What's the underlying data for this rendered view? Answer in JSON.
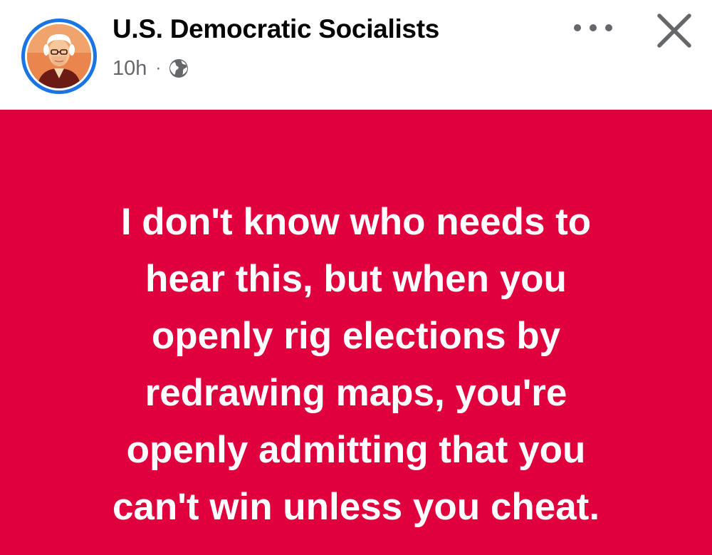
{
  "header": {
    "page_name": "U.S. Democratic Socialists",
    "time_ago": "10h",
    "separator": "·",
    "audience_icon": "globe-icon",
    "more_icon": "more-options-icon",
    "close_icon": "close-icon",
    "avatar_ring_color": "#1b74e4"
  },
  "post": {
    "background_color": "#e0003d",
    "text_color": "#ffffff",
    "lines": [
      "I don't know who needs to",
      "hear this, but when you",
      "openly rig elections by",
      "redrawing maps, you're",
      "openly admitting that you",
      "can't win unless you cheat."
    ]
  }
}
